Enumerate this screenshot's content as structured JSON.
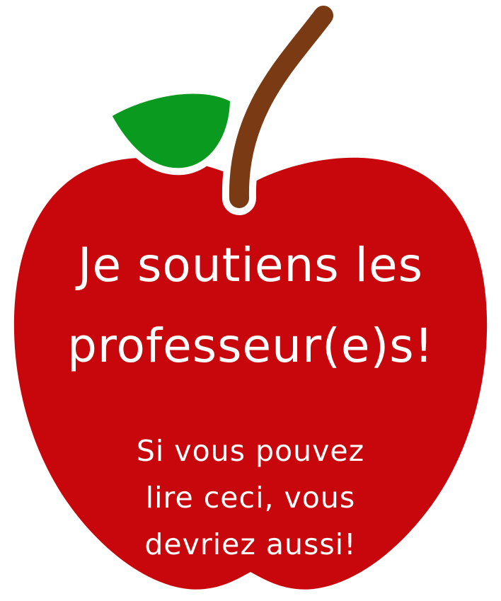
{
  "headline": {
    "line1": "Je soutiens les",
    "line2": "professeur(e)s!"
  },
  "subtext": {
    "line1": "Si vous pouvez",
    "line2": "lire ceci, vous",
    "line3": "devriez aussi!"
  },
  "colors": {
    "apple_red": "#c8070d",
    "leaf_green": "#0a9a1f",
    "stem_brown": "#7a3a14",
    "text": "#ffffff",
    "background": "#ffffff"
  },
  "icons": {
    "apple": "apple-icon",
    "leaf": "leaf-icon",
    "stem": "stem-icon"
  }
}
